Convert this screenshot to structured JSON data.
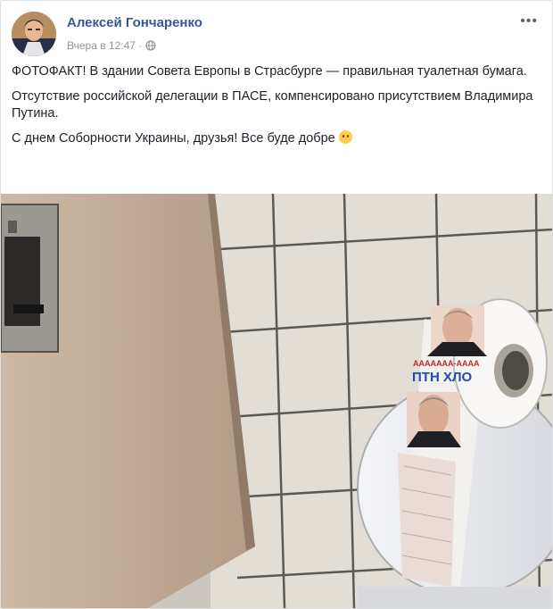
{
  "post": {
    "author": "Алексей Гончаренко",
    "timestamp": "Вчера в 12:47 ·",
    "audience_icon": "globe-icon",
    "menu_icon": "more-options-icon",
    "paragraphs": [
      "ФОТОФАКТ! В здании Совета Европы в Страсбурге — правильная туалетная бумага.",
      "Отсутствие российской делегации в ПАСЕ, компенсировано присутствием Владимира Путина.",
      "С днем Соборности Украины, друзья! Все буде добре"
    ],
    "emoji": "smiling-face-emoji"
  },
  "photo": {
    "roll_text_top": "ААААААА-АААА",
    "roll_text_main": "ПТН ХЛО"
  },
  "colors": {
    "author_link": "#365899",
    "meta_text": "#90949c",
    "body_text": "#1d2129",
    "tile_wall": "#e6e3dc",
    "grout": "#5c5854"
  }
}
